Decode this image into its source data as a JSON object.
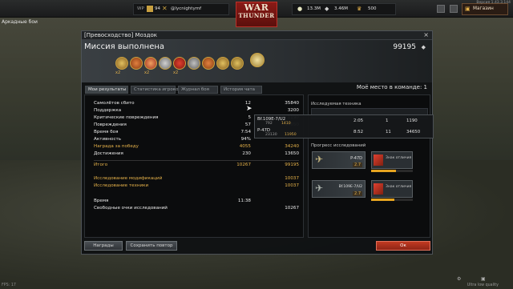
{
  "top_left_label": "Аркадные бои",
  "version": "Версия 1.43.3.144",
  "fps": "FPS: 17",
  "quality": "Ultra low quality",
  "player": {
    "wp_label": "WP",
    "rank": "94",
    "name": "@lycnightymf"
  },
  "logo": {
    "line1": "WAR",
    "line2": "THUNDER"
  },
  "currency": {
    "silver": "13.3M",
    "research": "3.46M",
    "gold": "500"
  },
  "shop_label": "Магазин",
  "window": {
    "title": "[Превосходство] Моздок",
    "mission_status": "Миссия выполнена",
    "mission_reward": "99195",
    "medal_labels": [
      "x2",
      "x2",
      "x2"
    ],
    "my_place": "Моё место в команде: 1",
    "tabs": [
      "Мои результаты",
      "Статистика игроков",
      "Журнал боя",
      "История чата"
    ]
  },
  "results": {
    "rows": [
      {
        "label": "Самолётов сбито",
        "count": "12",
        "reward": "35840"
      },
      {
        "label": "Поддержка",
        "count": "",
        "reward": "3200"
      },
      {
        "label": "Критические повреждения",
        "count": "5",
        "reward": "1190"
      },
      {
        "label": "Повреждения",
        "count": "57",
        "reward": "34650"
      },
      {
        "label": "Время боя",
        "count": "7:54",
        "reward": ""
      },
      {
        "label": "Активность",
        "count": "94%",
        "reward": ""
      },
      {
        "label": "Награда за победу",
        "count": "4055",
        "reward": "34240"
      },
      {
        "label": "Достижения",
        "count": "230",
        "reward": "13650"
      }
    ],
    "total_label": "Итого",
    "total_count": "10267",
    "total_reward": "99195",
    "mod_research_label": "Исследование модификаций",
    "mod_research_value": "10037",
    "tech_research_label": "Исследование техники",
    "tech_research_value": "10037",
    "time_label": "Время",
    "time_value": "11:38",
    "free_rp_label": "Свободные очки исследований",
    "free_rp_value": "10267"
  },
  "tooltip": {
    "rows": [
      {
        "name": "Bf.109E-7/U2",
        "sub1": "792",
        "sub2": "1410",
        "time": "2:05",
        "kills": "1",
        "reward": "1190"
      },
      {
        "name": "P-47D",
        "sub1": "23130",
        "sub2": "11950",
        "time": "8:52",
        "kills": "11",
        "reward": "34650"
      }
    ]
  },
  "research": {
    "title": "Исследуемая техника",
    "progress_title": "Прогресс исследований",
    "cards": [
      {
        "plane": "P-47D",
        "rank": "2.7",
        "mod_label": "Знак отличия",
        "progress": 0.6
      },
      {
        "plane": "Bf.109E-7/U2",
        "rank": "2.7",
        "mod_label": "Знак отличия",
        "progress": 0.55
      }
    ]
  },
  "buttons": {
    "awards": "Награды",
    "save_replay": "Сохранить повтор",
    "ok": "Ок"
  }
}
